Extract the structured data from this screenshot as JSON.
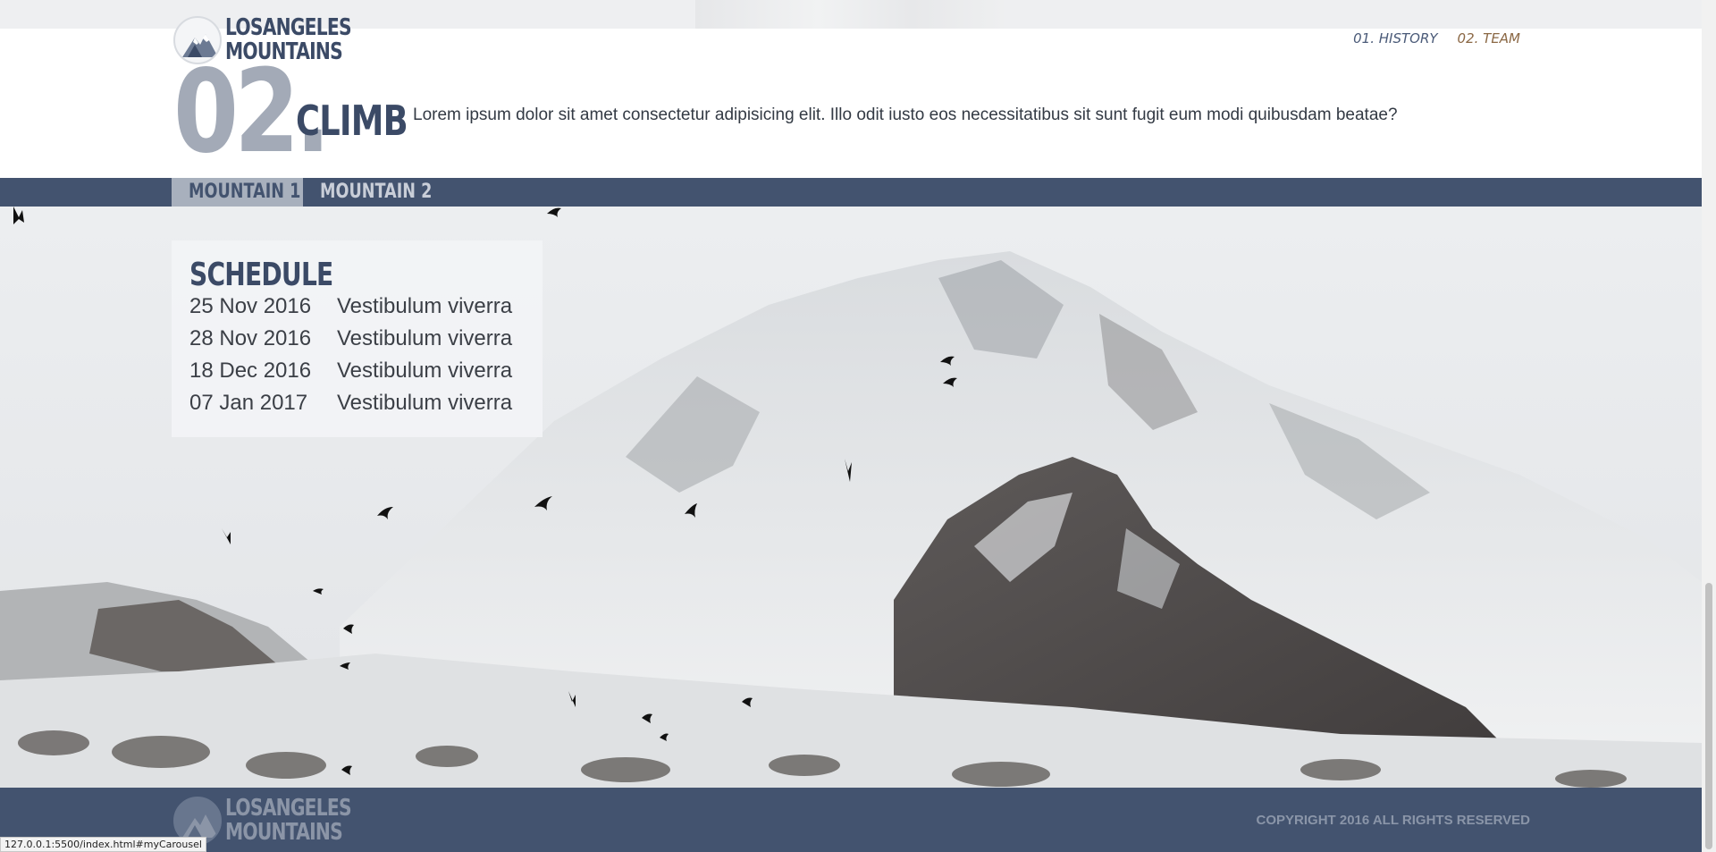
{
  "header": {
    "logo": {
      "line1": "LOSANGELES",
      "line2": "MOUNTAINS",
      "icon": "mountain-logo-icon"
    },
    "nav": [
      {
        "label": "01. HISTORY",
        "active": false
      },
      {
        "label": "02. TEAM",
        "active": true
      }
    ]
  },
  "section": {
    "number": "02.",
    "title": "CLIMB",
    "description": "Lorem ipsum dolor sit amet consectetur adipisicing elit. Illo odit iusto eos necessitatibus sit sunt fugit eum modi quibusdam beatae?"
  },
  "tabs": [
    {
      "label": "MOUNTAIN 1",
      "active": true
    },
    {
      "label": "MOUNTAIN 2",
      "active": false
    }
  ],
  "schedule": {
    "title": "SCHEDULE",
    "rows": [
      {
        "date": "25 Nov 2016",
        "event": "Vestibulum viverra"
      },
      {
        "date": "28 Nov 2016",
        "event": "Vestibulum viverra"
      },
      {
        "date": "18 Dec 2016",
        "event": "Vestibulum viverra"
      },
      {
        "date": "07 Jan 2017",
        "event": "Vestibulum viverra"
      }
    ]
  },
  "footer": {
    "logo": {
      "line1": "LOSANGELES",
      "line2": "MOUNTAINS"
    },
    "copyright": "COPYRIGHT 2016 ALL RIGHTS RESERVED"
  },
  "statusbar": {
    "url": "127.0.0.1:5500/index.html#myCarousel"
  },
  "colors": {
    "navy": "#43536f",
    "active_tab_bg": "#a8b0bd",
    "accent_brown": "#8b6845",
    "number_gray": "#a3aab7"
  }
}
